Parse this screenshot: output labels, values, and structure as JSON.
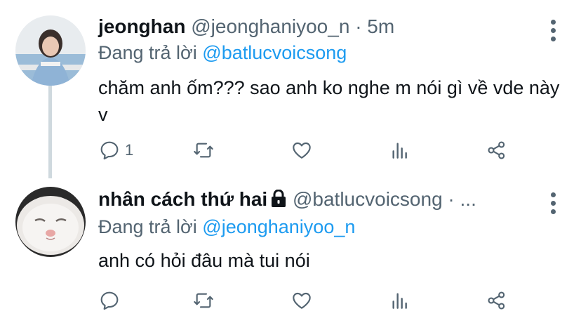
{
  "tweets": [
    {
      "name": "jeonghan",
      "handle": "@jeonghaniyoo_n",
      "time": "· 5m",
      "reply_prefix": "Đang trả lời",
      "reply_to": "@batlucvoicsong",
      "text": "chăm anh ốm??? sao anh ko nghe m nói gì về vde này v",
      "reply_count": "1",
      "avatar_icon": "person-photo"
    },
    {
      "name": "nhân cách thứ hai",
      "handle": "@batlucvoicsong",
      "time": "· ...",
      "reply_prefix": "Đang trả lời",
      "reply_to": "@jeonghaniyoo_n",
      "text": "anh có hỏi đâu mà tui nói",
      "reply_count": "",
      "avatar_icon": "cat-photo"
    }
  ],
  "colors": {
    "link": "#1d9bf0",
    "muted": "#536471",
    "text": "#0f1419",
    "thread_line": "#cfd9de"
  }
}
